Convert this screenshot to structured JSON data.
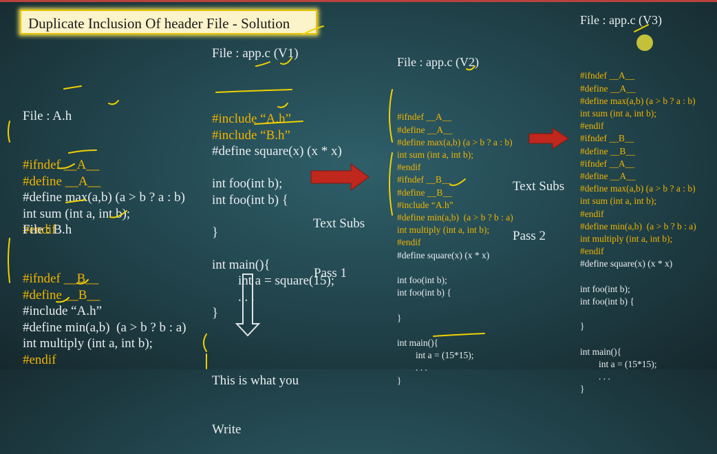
{
  "title": "Duplicate Inclusion Of header File - Solution",
  "file_a": {
    "header": "File : A.h",
    "lines": [
      {
        "text": "#ifndef __A__",
        "color": "yellow"
      },
      {
        "text": "#define __A__",
        "color": "yellow"
      },
      {
        "text": "#define max(a,b) (a > b ? a : b)",
        "color": "white"
      },
      {
        "text": "int sum (int a, int b);",
        "color": "white"
      },
      {
        "text": "#endif",
        "color": "yellow"
      }
    ]
  },
  "file_b": {
    "header": "File : B.h",
    "lines": [
      {
        "text": "#ifndef __B__",
        "color": "yellow"
      },
      {
        "text": "#define __B__",
        "color": "yellow"
      },
      {
        "text": "#include “A.h”",
        "color": "white"
      },
      {
        "text": "#define min(a,b)  (a > b ? b : a)",
        "color": "white"
      },
      {
        "text": "int multiply (int a, int b);",
        "color": "white"
      },
      {
        "text": "#endif",
        "color": "yellow"
      }
    ]
  },
  "app_v1": {
    "header": "File : app.c (V1)",
    "lines": [
      {
        "text": "#include “A.h”",
        "color": "yellow"
      },
      {
        "text": "#include “B.h”",
        "color": "yellow"
      },
      {
        "text": "#define square(x) (x * x)",
        "color": "white"
      },
      {
        "text": "",
        "color": "white"
      },
      {
        "text": "int foo(int b);",
        "color": "white"
      },
      {
        "text": "int foo(int b) {",
        "color": "white"
      },
      {
        "text": "",
        "color": "white"
      },
      {
        "text": "}",
        "color": "white"
      },
      {
        "text": "",
        "color": "white"
      },
      {
        "text": "int main(){",
        "color": "white"
      },
      {
        "text": "        int a = square(15);",
        "color": "white"
      },
      {
        "text": "        . . .",
        "color": "white"
      },
      {
        "text": "}",
        "color": "white"
      }
    ],
    "note_line1": "This is what you",
    "note_line2": "Write"
  },
  "pass1_label": {
    "line1": "Text Subs",
    "line2": "Pass 1"
  },
  "app_v2": {
    "header": "File : app.c (V2)",
    "lines": [
      {
        "text": "#ifndef __A__",
        "color": "yellow"
      },
      {
        "text": "#define __A__",
        "color": "yellow"
      },
      {
        "text": "#define max(a,b) (a > b ? a : b)",
        "color": "yellow"
      },
      {
        "text": "int sum (int a, int b);",
        "color": "yellow"
      },
      {
        "text": "#endif",
        "color": "yellow"
      },
      {
        "text": "#ifndef __B__",
        "color": "yellow"
      },
      {
        "text": "#define __B__",
        "color": "yellow"
      },
      {
        "text": "#include “A.h”",
        "color": "yellow"
      },
      {
        "text": "#define min(a,b)  (a > b ? b : a)",
        "color": "yellow"
      },
      {
        "text": "int multiply (int a, int b);",
        "color": "yellow"
      },
      {
        "text": "#endif",
        "color": "yellow"
      },
      {
        "text": "#define square(x) (x * x)",
        "color": "white"
      },
      {
        "text": "",
        "color": "white"
      },
      {
        "text": "int foo(int b);",
        "color": "white"
      },
      {
        "text": "int foo(int b) {",
        "color": "white"
      },
      {
        "text": "",
        "color": "white"
      },
      {
        "text": "}",
        "color": "white"
      },
      {
        "text": "",
        "color": "white"
      },
      {
        "text": "int main(){",
        "color": "white"
      },
      {
        "text": "        int a = (15*15);",
        "color": "white"
      },
      {
        "text": "        . . .",
        "color": "white"
      },
      {
        "text": "}",
        "color": "white"
      }
    ]
  },
  "pass2_label": {
    "line1": "Text Subs",
    "line2": "Pass 2"
  },
  "app_v3": {
    "header": "File : app.c (V3)",
    "lines": [
      {
        "text": "#ifndef __A__",
        "color": "yellow"
      },
      {
        "text": "#define __A__",
        "color": "yellow"
      },
      {
        "text": "#define max(a,b) (a > b ? a : b)",
        "color": "yellow"
      },
      {
        "text": "int sum (int a, int b);",
        "color": "yellow"
      },
      {
        "text": "#endif",
        "color": "yellow"
      },
      {
        "text": "#ifndef __B__",
        "color": "yellow"
      },
      {
        "text": "#define __B__",
        "color": "yellow"
      },
      {
        "text": "#ifndef __A__",
        "color": "yellow"
      },
      {
        "text": "#define __A__",
        "color": "yellow"
      },
      {
        "text": "#define max(a,b) (a > b ? a : b)",
        "color": "yellow"
      },
      {
        "text": "int sum (int a, int b);",
        "color": "yellow"
      },
      {
        "text": "#endif",
        "color": "yellow"
      },
      {
        "text": "#define min(a,b)  (a > b ? b : a)",
        "color": "yellow"
      },
      {
        "text": "int multiply (int a, int b);",
        "color": "yellow"
      },
      {
        "text": "#endif",
        "color": "yellow"
      },
      {
        "text": "#define square(x) (x * x)",
        "color": "white"
      },
      {
        "text": "",
        "color": "white"
      },
      {
        "text": "int foo(int b);",
        "color": "white"
      },
      {
        "text": "int foo(int b) {",
        "color": "white"
      },
      {
        "text": "",
        "color": "white"
      },
      {
        "text": "}",
        "color": "white"
      },
      {
        "text": "",
        "color": "white"
      },
      {
        "text": "int main(){",
        "color": "white"
      },
      {
        "text": "        int a = (15*15);",
        "color": "white"
      },
      {
        "text": "        . . .",
        "color": "white"
      },
      {
        "text": "}",
        "color": "white"
      }
    ]
  },
  "colors": {
    "yellow_text": "#f0b400",
    "white_text": "#e9eef0",
    "arrow_red": "#c0271d",
    "title_bg": "#fbf3c9",
    "title_border": "#e5c100",
    "ink": "#f2d200"
  }
}
